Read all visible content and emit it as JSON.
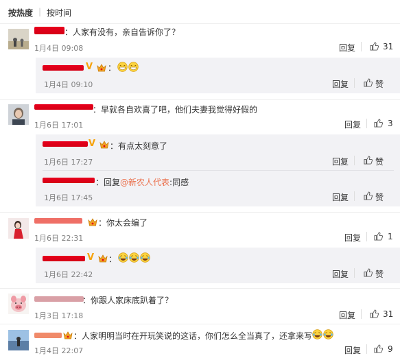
{
  "sort": {
    "hot": "按热度",
    "sep": "|",
    "time": "按时间"
  },
  "actions": {
    "reply": "回复",
    "like": "赞"
  },
  "colors": {
    "accent": "#eb7350",
    "redact": "#e2001a",
    "vip": "#f6a20a"
  },
  "comments": [
    {
      "text": "：人家有没有，亲自告诉你了？",
      "time": "1月4日 09:08",
      "likes": "31"
    },
    {
      "text": "：早就各自欢喜了吧，他们夫妻我觉得好假的",
      "time": "1月6日 17:01",
      "likes": "3"
    },
    {
      "text": "：你太会编了",
      "time": "1月6日 22:31",
      "likes": "1"
    },
    {
      "text": "：你跟人家床底趴着了？",
      "time": "1月3日 17:18",
      "likes": "31"
    },
    {
      "text": "：人家明明当时在开玩笑说的这话，你们怎么全当真了，还拿来写",
      "time": "1月4日 22:07",
      "likes": "9"
    }
  ],
  "replies": [
    {
      "text": "：",
      "time": "1月4日 09:10",
      "emoji": "grin-emoji x2"
    },
    {
      "text": "：有点太刻意了",
      "time": "1月6日 17:27"
    },
    {
      "prefix": "：回复",
      "mention": "@新农人代表",
      "suffix": ":同感",
      "time": "1月6日 17:45"
    },
    {
      "text": "：",
      "time": "1月6日 22:42",
      "emoji": "laugh-cry-emoji x3"
    }
  ]
}
